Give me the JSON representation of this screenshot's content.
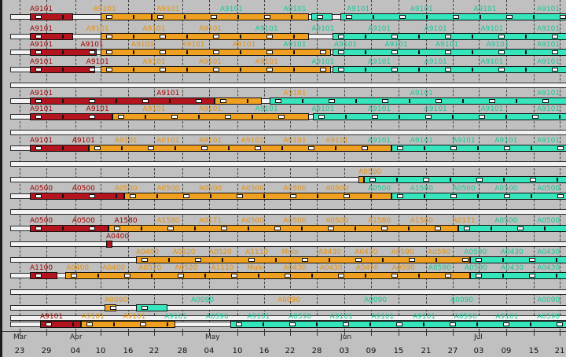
{
  "timeline": {
    "month_labels": [
      "Mar",
      "Apr",
      "May",
      "Jun",
      "Jul"
    ],
    "day_labels": [
      "23",
      "29",
      "04",
      "10",
      "16",
      "22",
      "28",
      "04",
      "10",
      "16",
      "22",
      "28",
      "03",
      "09",
      "15",
      "21",
      "27",
      "03",
      "09",
      "15",
      "21"
    ]
  },
  "colors": {
    "red": "#b4141e",
    "orange": "#f0a020",
    "teal": "#35e6bc",
    "track": "#f2f2f2"
  },
  "rows": [
    {
      "labels": [
        [
          "A9101",
          "red"
        ],
        [
          "A9101",
          "orange"
        ],
        [
          "A9101",
          "orange"
        ],
        [
          "A9101",
          "teal"
        ],
        [
          "A9101",
          "teal"
        ],
        [
          "A9101",
          "teal"
        ],
        [
          "A9101",
          "teal"
        ],
        [
          "A9101",
          "teal"
        ],
        [
          "A9101",
          "teal"
        ]
      ]
    },
    {
      "labels": [
        [
          "A9101",
          "red"
        ],
        [
          "A9101",
          "orange"
        ],
        [
          "A9101",
          "orange"
        ],
        [
          "A9101",
          "orange"
        ],
        [
          "A9101",
          "teal"
        ],
        [
          "A9101",
          "teal"
        ],
        [
          "A9101",
          "teal"
        ],
        [
          "A9101",
          "teal"
        ],
        [
          "A9101",
          "teal"
        ],
        [
          "A9101",
          "teal"
        ]
      ]
    },
    {
      "labels": [
        [
          "A9101",
          "red"
        ],
        [
          "A9101",
          "red"
        ],
        [
          "A9101",
          "orange"
        ],
        [
          "A9101",
          "orange"
        ],
        [
          "A9101",
          "orange"
        ],
        [
          "A9101",
          "teal"
        ],
        [
          "A9101",
          "teal"
        ],
        [
          "A9101",
          "teal"
        ],
        [
          "A9101",
          "teal"
        ],
        [
          "A9101",
          "teal"
        ],
        [
          "A9101",
          "teal"
        ]
      ]
    },
    {
      "labels": [
        [
          "A9101",
          "red"
        ],
        [
          "A9101",
          "red"
        ],
        [
          "A9101",
          "orange"
        ],
        [
          "A9101",
          "orange"
        ],
        [
          "A9101",
          "orange"
        ],
        [
          "A9101",
          "teal"
        ],
        [
          "A9101",
          "teal"
        ],
        [
          "A9101",
          "teal"
        ],
        [
          "A9101",
          "teal"
        ],
        [
          "A9101",
          "teal"
        ]
      ]
    },
    {
      "labels": []
    },
    {
      "labels": [
        [
          "A9101",
          "red"
        ],
        [
          "A9101",
          "red"
        ],
        [
          "A9101",
          "orange"
        ],
        [
          "A9101",
          "teal"
        ],
        [
          "A9101",
          "teal"
        ]
      ]
    },
    {
      "labels": [
        [
          "A9101",
          "red"
        ],
        [
          "A9101",
          "red"
        ],
        [
          "A9101",
          "orange"
        ],
        [
          "A9101",
          "orange"
        ],
        [
          "A9101",
          "teal"
        ],
        [
          "A9101",
          "teal"
        ],
        [
          "A9101",
          "teal"
        ],
        [
          "A9101",
          "teal"
        ],
        [
          "A9101",
          "teal"
        ],
        [
          "A9101",
          "teal"
        ]
      ]
    },
    {
      "labels": []
    },
    {
      "labels": [
        [
          "A9101",
          "red"
        ],
        [
          "A9101",
          "red"
        ],
        [
          "A9101",
          "orange"
        ],
        [
          "A0101",
          "orange"
        ],
        [
          "A9101",
          "orange"
        ],
        [
          "A9101",
          "orange"
        ],
        [
          "A0101",
          "orange"
        ],
        [
          "A9101",
          "orange"
        ],
        [
          "A9101",
          "teal"
        ],
        [
          "A9101",
          "teal"
        ],
        [
          "A9101",
          "teal"
        ],
        [
          "A9101",
          "teal"
        ],
        [
          "A9101",
          "teal"
        ]
      ]
    },
    {
      "labels": []
    },
    {
      "labels": [
        [
          "A0500",
          "orange"
        ]
      ]
    },
    {
      "labels": [
        [
          "A0500",
          "red"
        ],
        [
          "A0500",
          "red"
        ],
        [
          "A0500",
          "orange"
        ],
        [
          "A0500",
          "orange"
        ],
        [
          "A0500",
          "orange"
        ],
        [
          "A0500",
          "orange"
        ],
        [
          "A0500",
          "orange"
        ],
        [
          "A0500",
          "orange"
        ],
        [
          "A0500",
          "teal"
        ],
        [
          "A1580",
          "teal"
        ],
        [
          "A0500",
          "teal"
        ],
        [
          "A0500",
          "teal"
        ],
        [
          "A0500",
          "teal"
        ]
      ]
    },
    {
      "labels": []
    },
    {
      "labels": [
        [
          "A0500",
          "red"
        ],
        [
          "A0500",
          "red"
        ],
        [
          "A1580",
          "red"
        ],
        [
          "A1580",
          "orange"
        ],
        [
          "A0171",
          "orange"
        ],
        [
          "A0500",
          "orange"
        ],
        [
          "A0500",
          "orange"
        ],
        [
          "A0500",
          "orange"
        ],
        [
          "A1580",
          "orange"
        ],
        [
          "A1580",
          "orange"
        ],
        [
          "A0171",
          "orange"
        ],
        [
          "A0500",
          "teal"
        ],
        [
          "A0500",
          "teal"
        ]
      ]
    },
    {
      "labels": [
        [
          "A0400",
          "red"
        ]
      ]
    },
    {
      "labels": [
        [
          "A0400",
          "orange"
        ],
        [
          "A0520",
          "orange"
        ],
        [
          "A0520",
          "orange"
        ],
        [
          "A1110",
          "orange"
        ],
        [
          "Mulo",
          "orange"
        ],
        [
          "A0430",
          "orange"
        ],
        [
          "A0430",
          "orange"
        ],
        [
          "A0590",
          "orange"
        ],
        [
          "A0590",
          "orange"
        ],
        [
          "A0590",
          "teal"
        ],
        [
          "A0430",
          "teal"
        ],
        [
          "A0430",
          "teal"
        ]
      ]
    },
    {
      "labels": [
        [
          "A1100",
          "red"
        ],
        [
          "A0400",
          "orange"
        ],
        [
          "A0400",
          "orange"
        ],
        [
          "A0520",
          "orange"
        ],
        [
          "A0520",
          "orange"
        ],
        [
          "A1110",
          "orange"
        ],
        [
          "Mulo",
          "orange"
        ],
        [
          "A0430",
          "orange"
        ],
        [
          "A0430",
          "orange"
        ],
        [
          "A0430",
          "orange"
        ],
        [
          "A0590",
          "orange"
        ],
        [
          "A0590",
          "teal"
        ],
        [
          "A0590",
          "teal"
        ],
        [
          "A0430",
          "teal"
        ],
        [
          "A0430",
          "teal"
        ]
      ]
    },
    {
      "labels": []
    },
    {
      "labels": [
        [
          "A0090",
          "orange"
        ],
        [
          "A0090",
          "teal"
        ],
        [
          "A0090",
          "orange"
        ],
        [
          "A0090",
          "teal"
        ],
        [
          "A0090",
          "teal"
        ],
        [
          "A0090",
          "teal"
        ]
      ]
    },
    {
      "labels": []
    },
    {
      "labels": [
        [
          "A9101",
          "red"
        ],
        [
          "A9101",
          "orange"
        ],
        [
          "A9101",
          "orange"
        ],
        [
          "A9101",
          "teal"
        ],
        [
          "A0590",
          "teal"
        ],
        [
          "A9101",
          "teal"
        ],
        [
          "A0590",
          "teal"
        ],
        [
          "A9101",
          "teal"
        ],
        [
          "A9101",
          "teal"
        ],
        [
          "A9101",
          "teal"
        ],
        [
          "A0590",
          "teal"
        ],
        [
          "A9101",
          "teal"
        ],
        [
          "A0590",
          "teal"
        ]
      ]
    }
  ]
}
